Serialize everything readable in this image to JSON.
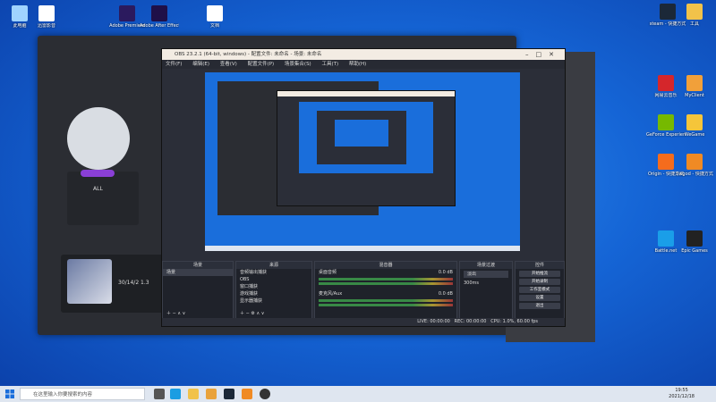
{
  "desktop_icons_left": [
    {
      "label": "此电脑",
      "color": "#9fd3ff"
    },
    {
      "label": "迅雷影音",
      "color": "#ffffff"
    },
    {
      "label": "Adobe Premiere",
      "color": "#2b1a5e"
    },
    {
      "label": "Adobe After Effects",
      "color": "#1f1048"
    },
    {
      "label": "文档",
      "color": "#ffffff"
    }
  ],
  "desktop_icons_right": [
    {
      "label": "steam - 快捷方式",
      "color": "#1b2838"
    },
    {
      "label": "工具",
      "color": "#f1c24a"
    },
    {
      "label": "网易云音乐",
      "color": "#d5262b"
    },
    {
      "label": "MyClient",
      "color": "#f1a03a"
    },
    {
      "label": "GeForce Experience",
      "color": "#76b900"
    },
    {
      "label": "WeGame",
      "color": "#f5c53a"
    },
    {
      "label": "Origin - 快捷方式",
      "color": "#f56c1d"
    },
    {
      "label": "Swgod - 快捷方式",
      "color": "#f08a24"
    },
    {
      "label": "Battle.net",
      "color": "#1a9ee8"
    },
    {
      "label": "Epic Games",
      "color": "#222"
    }
  ],
  "background_app": {
    "user_label": "ALL",
    "stats": "30/14/2  1.3"
  },
  "obs": {
    "title": "OBS 23.2.1 (64-bit, windows) - 配置文件: 未命名 - 场景: 未命名",
    "menu": [
      "文件(F)",
      "编辑(E)",
      "查看(V)",
      "配置文件(P)",
      "场景集合(S)",
      "工具(T)",
      "帮助(H)"
    ],
    "docks": {
      "scenes": {
        "title": "场景",
        "items": [
          "场景"
        ]
      },
      "sources": {
        "title": "来源",
        "items": [
          "音频输出捕获",
          "OBS",
          "窗口捕获",
          "游戏捕获",
          "显示器捕获"
        ]
      },
      "mixer": {
        "title": "混音器",
        "channels": [
          {
            "name": "桌面音频",
            "level": "0.0 dB"
          },
          {
            "name": "麦克风/Aux",
            "level": "0.0 dB"
          }
        ]
      },
      "transitions": {
        "title": "场景过渡",
        "mode": "淡出",
        "duration": "300ms"
      },
      "controls": {
        "title": "控件",
        "buttons": [
          "开始推流",
          "开始录制",
          "工作室模式",
          "设置",
          "退出"
        ]
      }
    },
    "status": {
      "live": "LIVE: 00:00:00",
      "rec": "REC: 00:00:00",
      "cpu": "CPU: 1.0%, 60.00 fps"
    }
  },
  "taskbar": {
    "search_placeholder": "在这里输入你要搜索的内容",
    "time": "19:55",
    "date": "2021/12/18"
  }
}
